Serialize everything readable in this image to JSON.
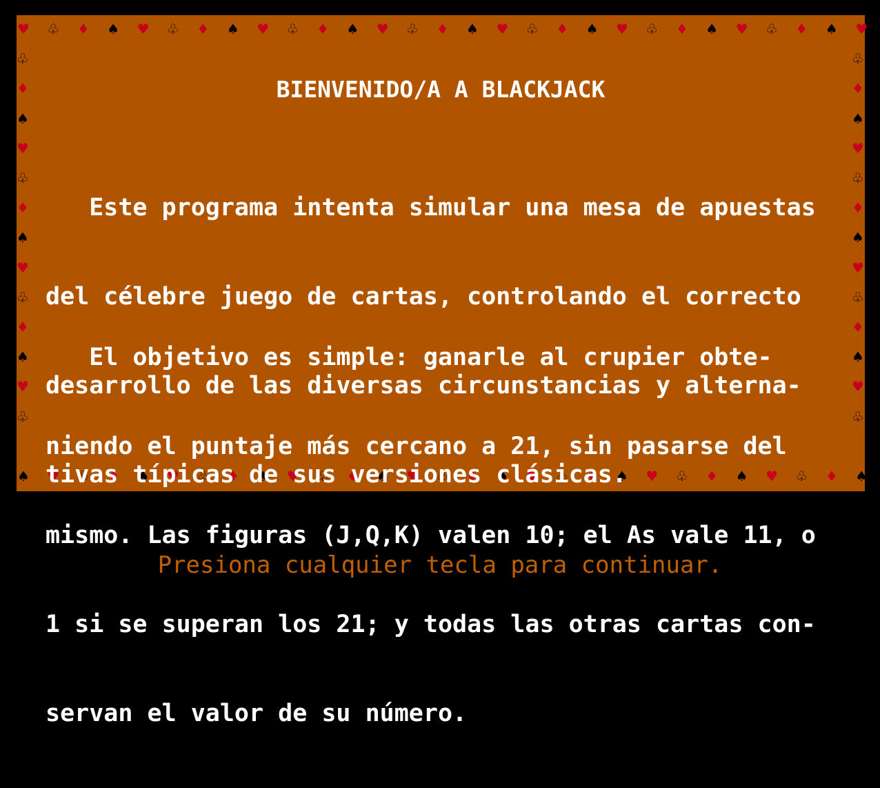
{
  "colors": {
    "background": "#000000",
    "panel": "#b05400",
    "text": "#ffffff",
    "heart_diamond": "#c8001e",
    "spade_club": "#000000",
    "prompt": "#c06000"
  },
  "border_suits": [
    "heart",
    "club",
    "diamond",
    "spade"
  ],
  "screen": {
    "title": "BIENVENIDO/A A BLACKJACK",
    "paragraph1": [
      "   Este programa intenta simular una mesa de apuestas",
      "del célebre juego de cartas, controlando el correcto",
      "desarrollo de las diversas circunstancias y alterna-",
      "tivas típicas de sus versiones clásicas."
    ],
    "paragraph2": [
      "   El objetivo es simple: ganarle al crupier obte-",
      "niendo el puntaje más cercano a 21, sin pasarse del",
      "mismo. Las figuras (J,Q,K) valen 10; el As vale 11, o",
      "1 si se superan los 21; y todas las otras cartas con-",
      "servan el valor de su número."
    ],
    "continue_prompt": "Presiona cualquier tecla para continuar."
  }
}
